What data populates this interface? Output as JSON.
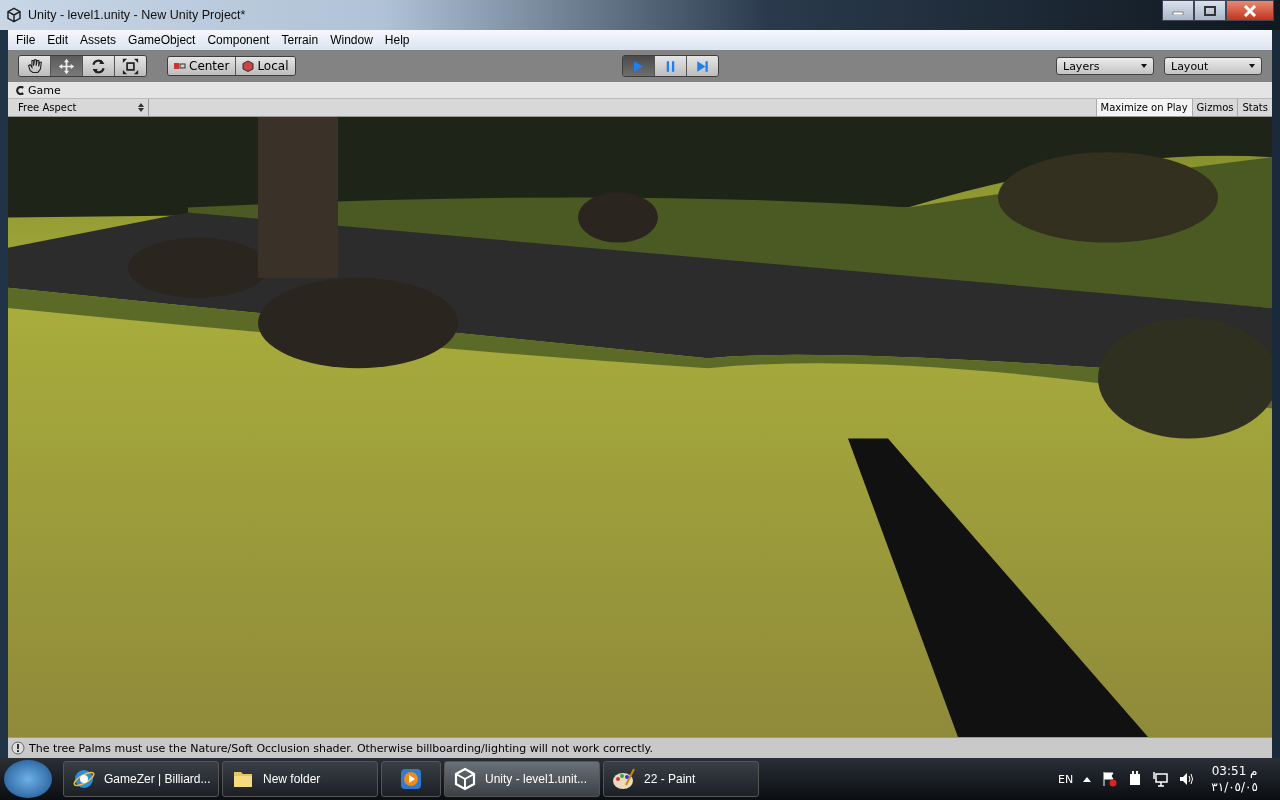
{
  "window": {
    "title": "Unity - level1.unity - New Unity Project*"
  },
  "menu": [
    "File",
    "Edit",
    "Assets",
    "GameObject",
    "Component",
    "Terrain",
    "Window",
    "Help"
  ],
  "toolbar": {
    "tools": [
      {
        "kind": "hand",
        "selected": false
      },
      {
        "kind": "move",
        "selected": true
      },
      {
        "kind": "rotate",
        "selected": false
      },
      {
        "kind": "scale",
        "selected": false
      }
    ],
    "pivot": [
      {
        "kind": "pivot",
        "label": "Center"
      },
      {
        "kind": "space",
        "label": "Local"
      }
    ],
    "playback": [
      {
        "kind": "play",
        "selected": true
      },
      {
        "kind": "pause",
        "selected": false
      },
      {
        "kind": "step",
        "selected": false
      }
    ],
    "dropdowns": [
      "Layers",
      "Layout"
    ]
  },
  "game_panel": {
    "tab": "Game",
    "aspect": "Free Aspect",
    "options": [
      {
        "label": "Maximize on Play",
        "selected": true
      },
      {
        "label": "Gizmos",
        "selected": false
      },
      {
        "label": "Stats",
        "selected": false
      }
    ]
  },
  "status_bar": {
    "message": "The tree Palms must use the Nature/Soft Occlusion shader. Otherwise billboarding/lighting will not work correctly."
  },
  "taskbar": {
    "items": [
      {
        "kind": "browser",
        "label": "GameZer | Billiard...",
        "selected": false
      },
      {
        "kind": "folder",
        "label": "New folder",
        "selected": false
      },
      {
        "kind": "media",
        "selected": false
      },
      {
        "kind": "unity",
        "label": "Unity - level1.unit...",
        "selected": true
      },
      {
        "kind": "paint",
        "label": "22 - Paint",
        "selected": false
      }
    ],
    "language": "EN",
    "time": "03:51 م",
    "date": "٣١/٠٥/٠٥"
  }
}
